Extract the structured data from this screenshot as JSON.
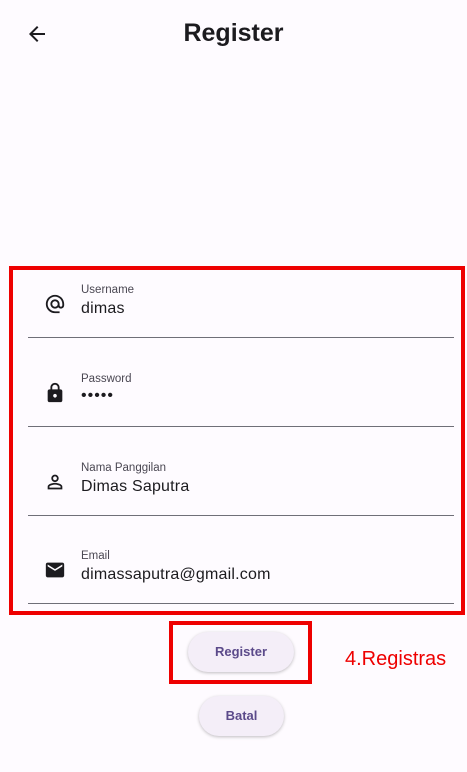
{
  "appbar": {
    "title": "Register",
    "back_icon": "arrow-left-icon"
  },
  "form": {
    "fields": [
      {
        "label": "Username",
        "value": "dimas",
        "icon": "at-sign-icon"
      },
      {
        "label": "Password",
        "value": "•••••",
        "icon": "lock-icon"
      },
      {
        "label": "Nama Panggilan",
        "value": "Dimas Saputra",
        "icon": "person-icon"
      },
      {
        "label": "Email",
        "value": "dimassaputra@gmail.com",
        "icon": "mail-icon"
      }
    ]
  },
  "actions": {
    "register_label": "Register",
    "cancel_label": "Batal"
  },
  "annotation": {
    "text": "4.Registras",
    "color": "#ee0000"
  },
  "colors": {
    "accent": "#5b4a8a",
    "button_bg": "#f4eef8"
  }
}
